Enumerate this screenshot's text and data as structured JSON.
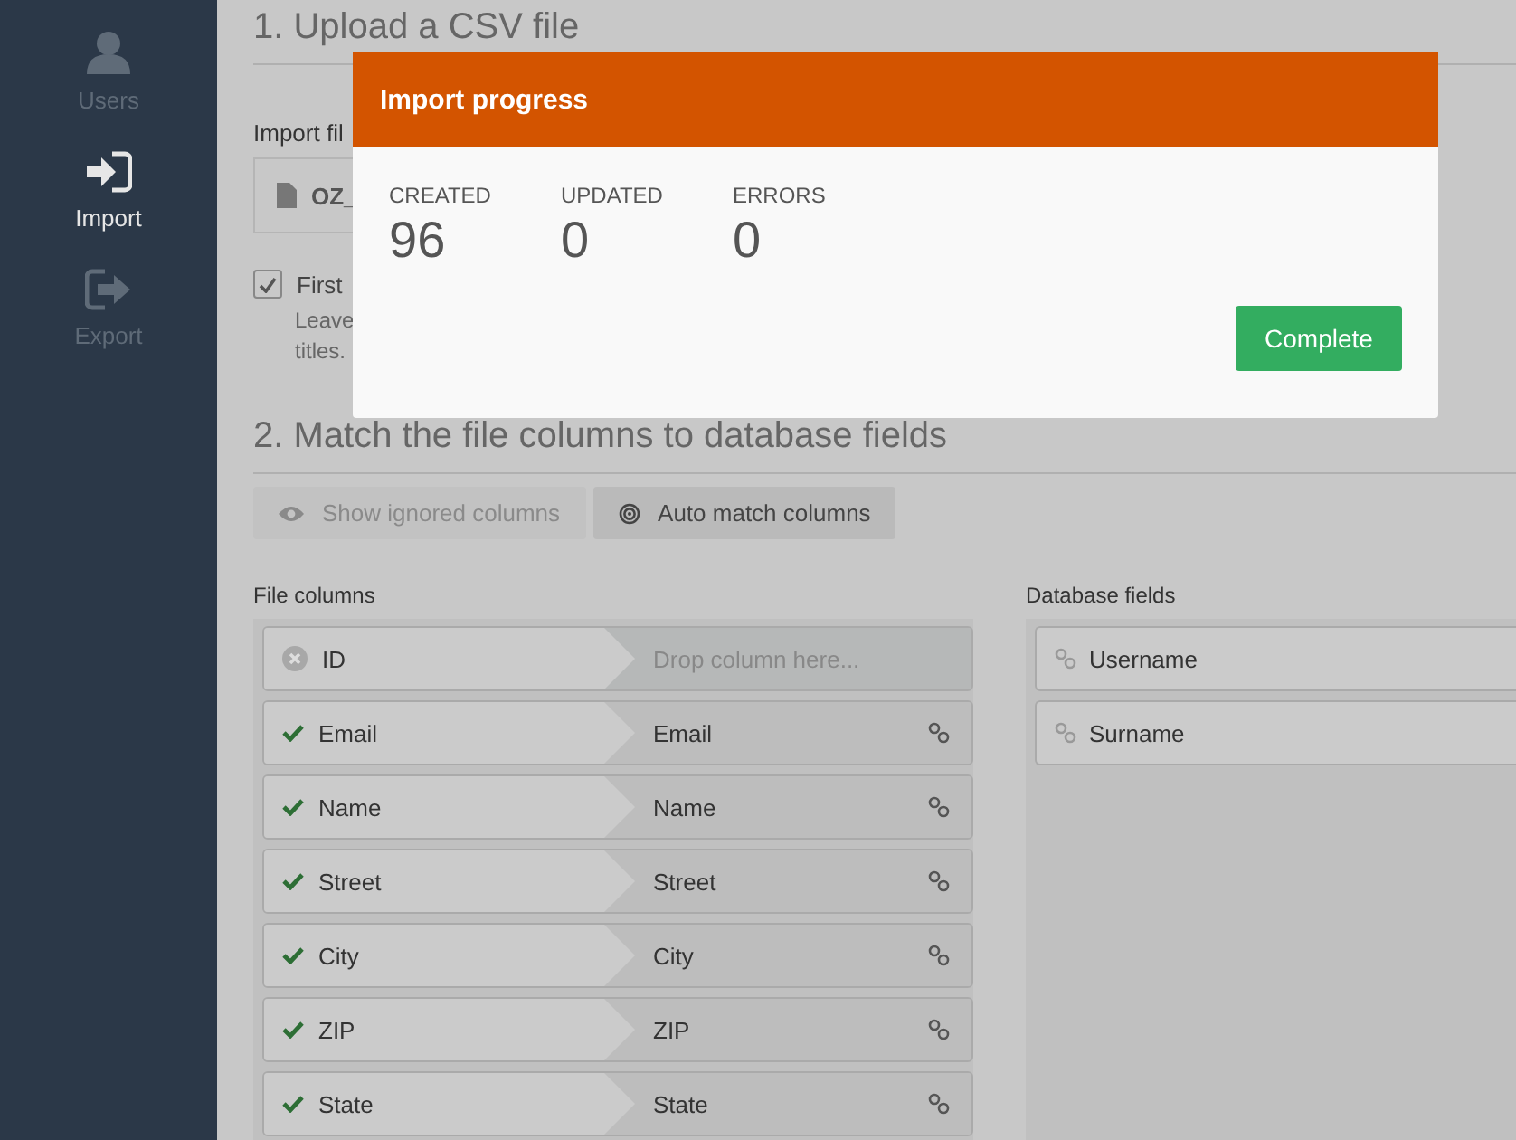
{
  "sidebar": {
    "items": [
      {
        "label": "Users",
        "selected": false
      },
      {
        "label": "Import",
        "selected": true
      },
      {
        "label": "Export",
        "selected": false
      }
    ]
  },
  "upload": {
    "heading": "1. Upload a CSV file",
    "file_label": "Import fil",
    "file_name": "OZ_",
    "first_row": {
      "label": "First",
      "checked": true,
      "help_lines": [
        "Leave",
        "titles."
      ]
    }
  },
  "match": {
    "heading": "2. Match the file columns to database fields",
    "buttons": [
      {
        "label": "Show ignored columns",
        "disabled": true
      },
      {
        "label": "Auto match columns",
        "disabled": false
      }
    ],
    "file_columns_title": "File columns",
    "rows": [
      {
        "column": "ID",
        "matched": false,
        "target": "Drop column here..."
      },
      {
        "column": "Email",
        "matched": true,
        "target": "Email"
      },
      {
        "column": "Name",
        "matched": true,
        "target": "Name"
      },
      {
        "column": "Street",
        "matched": true,
        "target": "Street"
      },
      {
        "column": "City",
        "matched": true,
        "target": "City"
      },
      {
        "column": "ZIP",
        "matched": true,
        "target": "ZIP"
      },
      {
        "column": "State",
        "matched": true,
        "target": "State"
      }
    ],
    "database_fields_title": "Database fields",
    "database_fields": [
      "Username",
      "Surname"
    ]
  },
  "modal": {
    "title": "Import progress",
    "stats": [
      {
        "label": "CREATED",
        "value": "96"
      },
      {
        "label": "UPDATED",
        "value": "0"
      },
      {
        "label": "ERRORS",
        "value": "0"
      }
    ],
    "button": "Complete"
  }
}
